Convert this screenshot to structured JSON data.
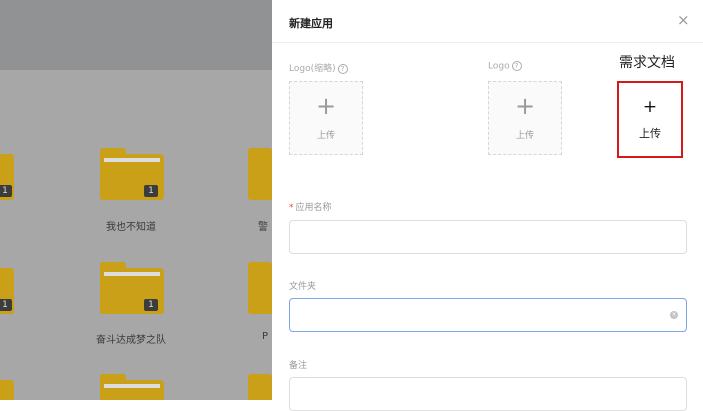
{
  "background": {
    "folders": [
      {
        "label": "我也不知道",
        "badge": "1"
      },
      {
        "label": "奋斗达成梦之队",
        "badge": "1"
      },
      {
        "label": "",
        "badge": ""
      }
    ],
    "left_badges": [
      "1",
      "1"
    ],
    "right_label_fragments": [
      "警",
      "P"
    ]
  },
  "dialog": {
    "title": "新建应用",
    "close_symbol": "×",
    "logo_small_label": "Logo(缩略)",
    "logo_label": "Logo",
    "help_symbol": "?",
    "upload_plus": "+",
    "upload_text": "上传",
    "requirement_doc_label": "需求文档",
    "app_name_required": "*",
    "app_name_label": "应用名称",
    "folder_label": "文件夹",
    "note_label": "备注",
    "app_name_value": "",
    "folder_value": "",
    "clear_symbol": "×"
  },
  "colors": {
    "folder_yellow": "#caa018",
    "highlight_red": "#d51919",
    "focus_blue": "#7fa6e8"
  }
}
